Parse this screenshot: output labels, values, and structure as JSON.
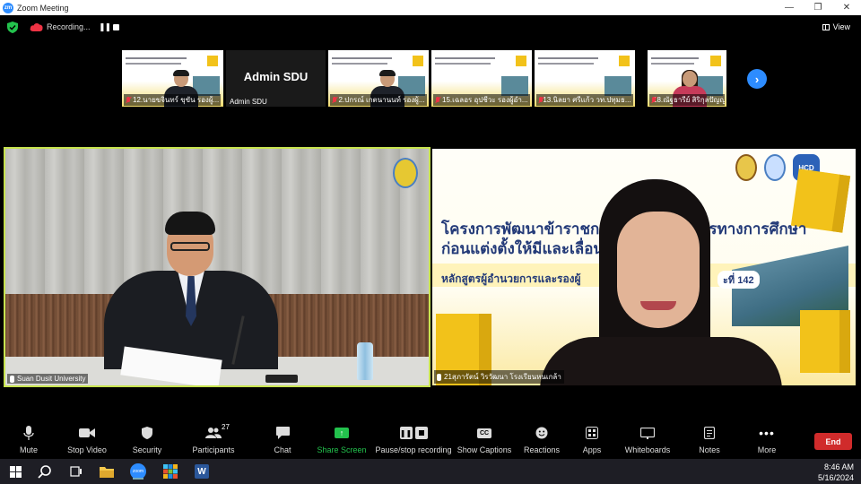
{
  "window": {
    "app_logo": "zm",
    "title": "Zoom Meeting",
    "controls": [
      "minimize",
      "restore",
      "close"
    ]
  },
  "status": {
    "recording_label": "Recording...",
    "view_label": "View",
    "icons": [
      "shield-check-icon",
      "cloud-recording-icon",
      "pause-icon",
      "stop-icon",
      "grid-view-icon"
    ],
    "shield_color": "#23c24d"
  },
  "thumbnails": [
    {
      "name": "12.นายขจินทร์ ขุขัน รองผู้...",
      "type": "video-male"
    },
    {
      "name": "Admin SDU",
      "big_label": "Admin SDU",
      "type": "name-only"
    },
    {
      "name": "2.ปกรณ์ เกตนานนท์ รองผู้...",
      "type": "video-male"
    },
    {
      "name": "15.เฉลอร อุปชีวะ รองผู้อำ...",
      "type": "slide"
    },
    {
      "name": "13.นิลยา ศรีแก้ว วท.ปทุมธ...",
      "type": "slide"
    },
    {
      "name": "18.ณัฐธารีย์ สิริกุลปัญญา...",
      "type": "video-female"
    }
  ],
  "main_videos": {
    "left_name": "Suan Dusit University",
    "right_name": "21สุภารัตน์ วิรวัฒนา โรงเรียนหนเกล้า",
    "active_speaker_border": "#c7e34f"
  },
  "slide": {
    "line1": "โครงการพัฒนาข้าราชการครูและบุคลากรทางการศึกษา",
    "line2": "ก่อนแต่งตั้งให้มีและเลื่อนเป็นวิท",
    "line3": "หลักสูตรผู้อำนวยการและรองผู้",
    "batch": "ะที่ 142",
    "logo3": "HCD"
  },
  "toolbar": {
    "items": [
      {
        "label": "Mute",
        "icon": "microphone-icon",
        "caret": true
      },
      {
        "label": "Stop Video",
        "icon": "video-camera-icon",
        "caret": true
      },
      {
        "label": "Security",
        "icon": "security-shield-icon",
        "caret": false
      },
      {
        "label": "Participants",
        "icon": "participants-icon",
        "count": "27",
        "caret": true
      },
      {
        "label": "Chat",
        "icon": "chat-bubble-icon",
        "caret": true
      },
      {
        "label": "Share Screen",
        "icon": "share-screen-icon",
        "caret": true
      },
      {
        "label": "Pause/stop recording",
        "icon": "pause-stop-icon",
        "caret": false
      },
      {
        "label": "Show Captions",
        "icon": "cc-icon",
        "caret": true
      },
      {
        "label": "Reactions",
        "icon": "emoji-icon",
        "caret": true
      },
      {
        "label": "Apps",
        "icon": "apps-icon",
        "caret": true
      },
      {
        "label": "Whiteboards",
        "icon": "whiteboard-icon",
        "caret": true
      },
      {
        "label": "Notes",
        "icon": "notes-icon",
        "caret": true
      },
      {
        "label": "More",
        "icon": "more-dots-icon",
        "caret": false
      }
    ],
    "cc_text": "CC",
    "end_label": "End",
    "end_color": "#d02b2b"
  },
  "taskbar": {
    "apps": [
      "windows-start-icon",
      "search-icon",
      "task-view-icon",
      "file-explorer-icon",
      "zoom-app-icon",
      "start-menu-tiles-icon",
      "word-icon"
    ],
    "zoom_text": "zoom",
    "word_text": "W",
    "time": "8:46 AM",
    "date": "5/16/2024"
  }
}
